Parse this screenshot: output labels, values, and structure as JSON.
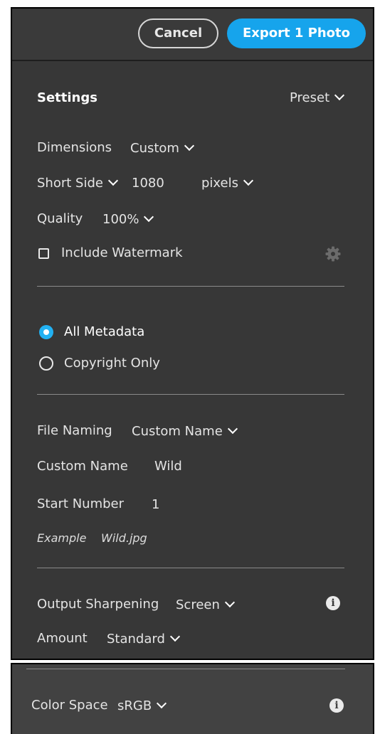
{
  "toolbar": {
    "cancel_label": "Cancel",
    "export_label": "Export 1 Photo"
  },
  "settings": {
    "title": "Settings",
    "preset_label": "Preset",
    "dimensions_label": "Dimensions",
    "dimensions_value": "Custom",
    "side_label": "Short Side",
    "side_value": "1080",
    "unit_value": "pixels",
    "quality_label": "Quality",
    "quality_value": "100%",
    "watermark_label": "Include Watermark",
    "watermark_checked": false
  },
  "metadata": {
    "options": [
      {
        "label": "All Metadata",
        "selected": true
      },
      {
        "label": "Copyright Only",
        "selected": false
      }
    ]
  },
  "naming": {
    "file_naming_label": "File Naming",
    "file_naming_value": "Custom Name",
    "custom_name_label": "Custom Name",
    "custom_name_value": "Wild",
    "start_number_label": "Start Number",
    "start_number_value": "1",
    "example_label": "Example",
    "example_value": "Wild.jpg"
  },
  "sharpening": {
    "label": "Output Sharpening",
    "value": "Screen",
    "amount_label": "Amount",
    "amount_value": "Standard"
  },
  "color_space": {
    "label": "Color Space",
    "value": "sRGB"
  },
  "colors": {
    "panel": "#373737",
    "accent": "#16a4ec",
    "text": "#e4e4e4"
  }
}
